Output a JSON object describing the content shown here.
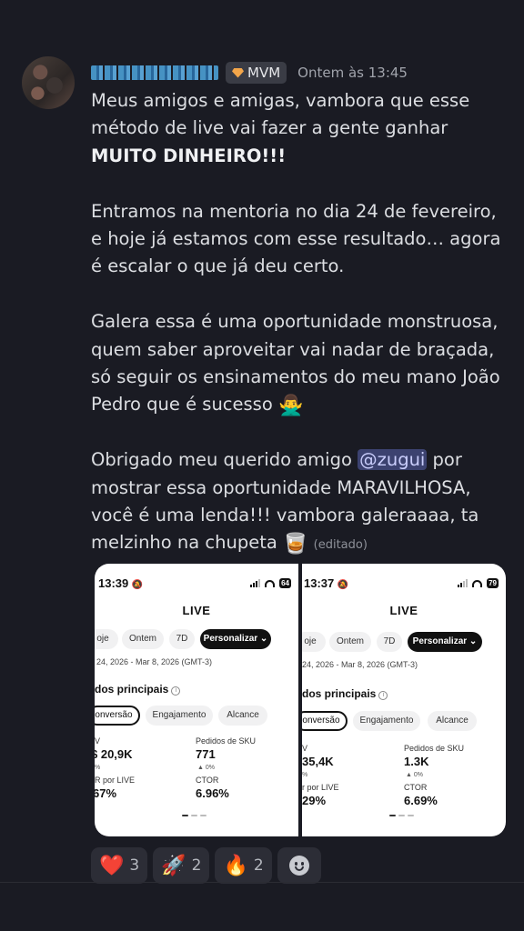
{
  "message": {
    "username": "redacted user",
    "badge_label": "MVM",
    "timestamp": "Ontem às 13:45",
    "p1_text": "Meus amigos e amigas, vambora que esse método de live vai fazer a gente ganhar ",
    "p1_bold": "MUITO DINHEIRO!!!",
    "p2": "Entramos na mentoria no dia 24 de fevereiro, e hoje já estamos com esse resultado… agora é escalar o que já deu certo.",
    "p3": "Galera essa é uma oportunidade monstruosa, quem saber aproveitar vai nadar de braçada, só seguir os ensinamentos do meu mano João Pedro que é sucesso",
    "p3_emoji": "🙅‍♂️",
    "p4_start": "Obrigado meu querido amigo ",
    "mention": "@zugui",
    "p4_end": " por mostrar essa oportunidade MARAVILHOSA, você é uma lenda!!! vambora galeraaaa, ta melzinho na chupeta",
    "p4_emoji": "🥃",
    "edited": "(editado)"
  },
  "screens": [
    {
      "time": "13:39",
      "battery": "64",
      "title": "LIVE",
      "chips": [
        "oje",
        "Ontem",
        "7D",
        "Personalizar"
      ],
      "date_range": "24, 2026 - Mar 8, 2026 (GMT-3)",
      "section": "dos principais",
      "tabs": [
        "onversão",
        "Engajamento",
        "Alcance"
      ],
      "m1_label": "V",
      "m1_value": "$ 20,9K",
      "m1_sub": "%",
      "m2_label": "Pedidos de SKU",
      "m2_value": "771",
      "m2_sub": "▲ 0%",
      "m3_label": "R por LIVE",
      "m3_value": "67%",
      "m4_label": "CTOR",
      "m4_value": "6.96%"
    },
    {
      "time": "13:37",
      "battery": "79",
      "title": "LIVE",
      "chips": [
        "oje",
        "Ontem",
        "7D",
        "Personalizar"
      ],
      "date_range": "24, 2026 - Mar 8, 2026 (GMT-3)",
      "section": "dos principais",
      "tabs": [
        "onversão",
        "Engajamento",
        "Alcance"
      ],
      "m1_label": "V",
      "m1_value": "35,4K",
      "m1_sub": "%",
      "m2_label": "Pedidos de SKU",
      "m2_value": "1.3K",
      "m2_sub": "▲ 0%",
      "m3_label": "r por LIVE",
      "m3_value": "29%",
      "m4_label": "CTOR",
      "m4_value": "6.69%"
    }
  ],
  "reactions": [
    {
      "emoji": "❤️",
      "count": "3"
    },
    {
      "emoji": "🚀",
      "count": "2"
    },
    {
      "emoji": "🔥",
      "count": "2"
    }
  ]
}
